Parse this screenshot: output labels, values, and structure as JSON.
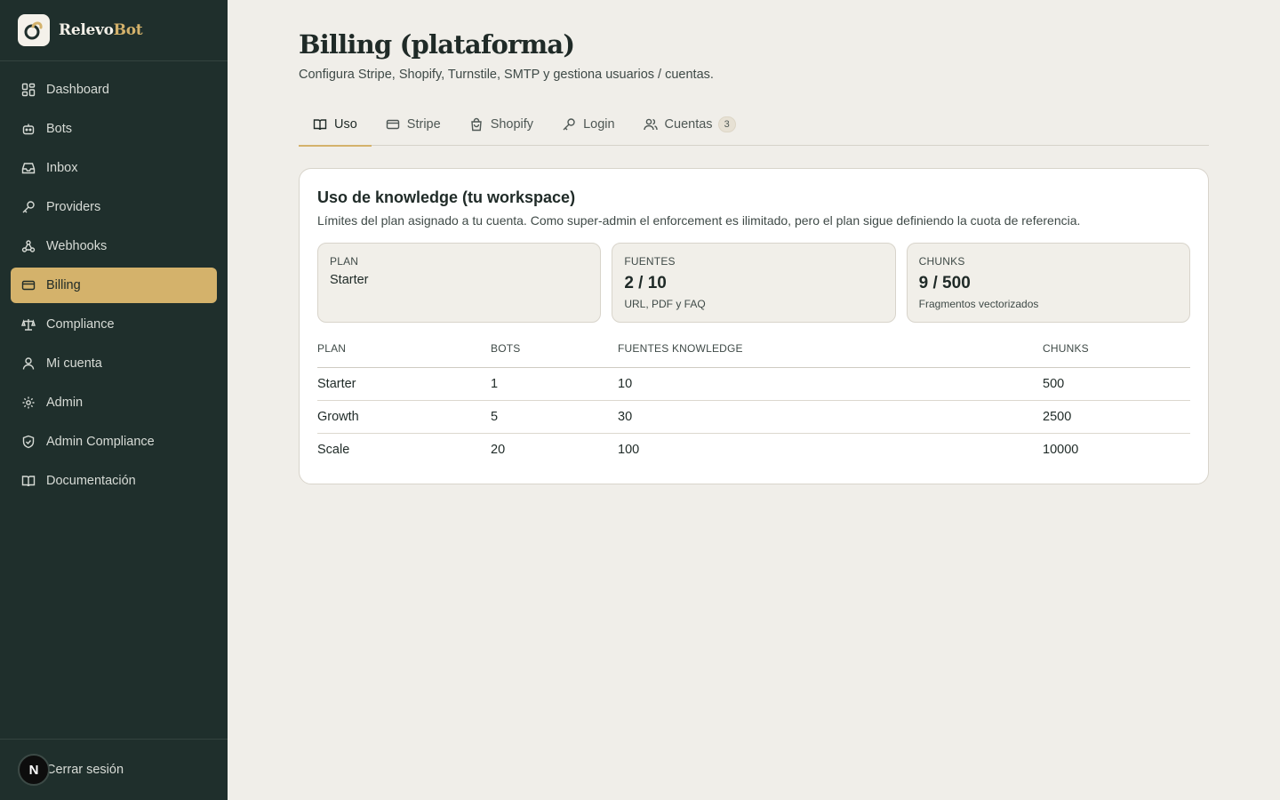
{
  "brand": {
    "name_part1": "Relevo",
    "name_part2": "Bot",
    "accent": "#d4b26b"
  },
  "sidebar": {
    "items": [
      {
        "label": "Dashboard",
        "icon": "dashboard-icon"
      },
      {
        "label": "Bots",
        "icon": "bot-icon"
      },
      {
        "label": "Inbox",
        "icon": "inbox-icon"
      },
      {
        "label": "Providers",
        "icon": "key-icon"
      },
      {
        "label": "Webhooks",
        "icon": "webhook-icon"
      },
      {
        "label": "Billing",
        "icon": "credit-card-icon",
        "active": true
      },
      {
        "label": "Compliance",
        "icon": "scale-icon"
      },
      {
        "label": "Mi cuenta",
        "icon": "user-icon"
      },
      {
        "label": "Admin",
        "icon": "gear-icon"
      },
      {
        "label": "Admin Compliance",
        "icon": "shield-check-icon"
      },
      {
        "label": "Documentación",
        "icon": "book-icon"
      }
    ],
    "footer": {
      "avatar_letter": "N",
      "logout_label": "Cerrar sesión"
    }
  },
  "page": {
    "title": "Billing (plataforma)",
    "subtitle": "Configura Stripe, Shopify, Turnstile, SMTP y gestiona usuarios / cuentas."
  },
  "tabs": [
    {
      "label": "Uso",
      "icon": "book-open-icon",
      "active": true
    },
    {
      "label": "Stripe",
      "icon": "credit-card-icon"
    },
    {
      "label": "Shopify",
      "icon": "shopping-bag-icon"
    },
    {
      "label": "Login",
      "icon": "key-icon"
    },
    {
      "label": "Cuentas",
      "icon": "users-icon",
      "badge": "3"
    }
  ],
  "card": {
    "title": "Uso de knowledge (tu workspace)",
    "subtitle": "Límites del plan asignado a tu cuenta. Como super-admin el enforcement es ilimitado, pero el plan sigue definiendo la cuota de referencia.",
    "stats": {
      "plan": {
        "label": "PLAN",
        "value": "Starter"
      },
      "fuentes": {
        "label": "FUENTES",
        "value": "2 / 10",
        "note": "URL, PDF y FAQ"
      },
      "chunks": {
        "label": "CHUNKS",
        "value": "9 / 500",
        "note": "Fragmentos vectorizados"
      }
    },
    "table": {
      "headers": [
        "PLAN",
        "BOTS",
        "FUENTES KNOWLEDGE",
        "CHUNKS"
      ],
      "rows": [
        [
          "Starter",
          "1",
          "10",
          "500"
        ],
        [
          "Growth",
          "5",
          "30",
          "2500"
        ],
        [
          "Scale",
          "20",
          "100",
          "10000"
        ]
      ]
    }
  }
}
